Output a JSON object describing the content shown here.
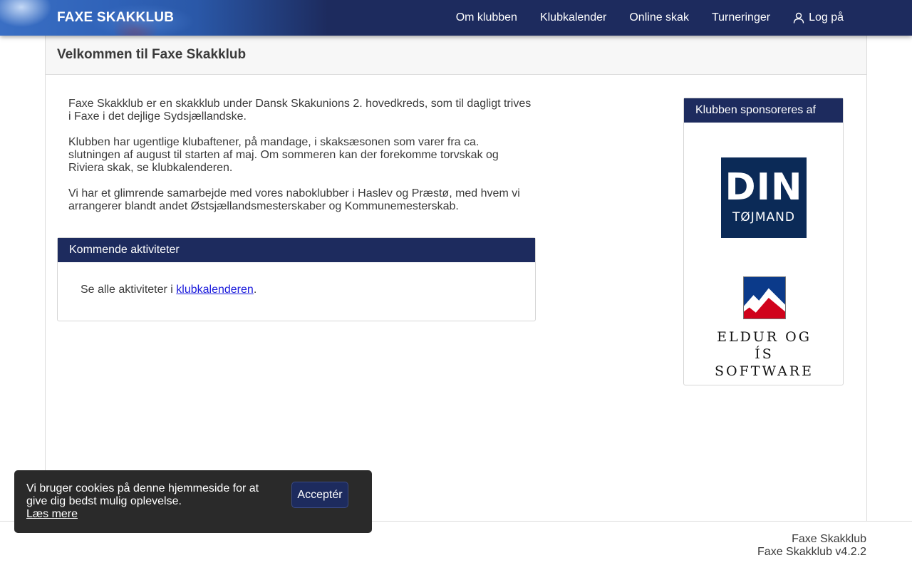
{
  "header": {
    "brand": "FAXE SKAKKLUB",
    "nav": [
      {
        "label": "Om klubben"
      },
      {
        "label": "Klubkalender"
      },
      {
        "label": "Online skak"
      },
      {
        "label": "Turneringer"
      },
      {
        "label": "Log på",
        "icon": "user-icon"
      }
    ]
  },
  "page": {
    "title": "Velkommen til Faxe Skakklub",
    "intro": [
      "Faxe Skakklub er en skakklub under Dansk Skakunions 2. hovedkreds, som til dagligt trives i Faxe i det dejlige Sydsjællandske.",
      "Klubben har ugentlige klubaftener, på mandage, i skaksæsonen som varer fra ca. slutningen af august til starten af maj. Om sommeren kan der forekomme torvskak og Riviera skak, se klubkalenderen.",
      "Vi har et glimrende samarbejde med vores naboklubber i Haslev og Præstø, med hvem vi arrangerer blandt andet Østsjællandsmesterskaber og Kommunemesterskab."
    ]
  },
  "activities": {
    "title": "Kommende aktiviteter",
    "text_before": "Se alle aktiviteter i ",
    "link_label": "klubkalenderen",
    "text_after": "."
  },
  "sponsors": {
    "title": "Klubben sponsoreres af",
    "din": {
      "line1": "DIN",
      "line2": "TØJMAND"
    },
    "eldur": {
      "line1": "ELDUR OG ÍS",
      "line2": "SOFTWARE"
    }
  },
  "footer": {
    "line1": "Faxe Skakklub",
    "line2": "Faxe Skakklub v4.2.2"
  },
  "cookie": {
    "text": "Vi bruger cookies på denne hjemmeside for at give dig bedst mulig oplevelse.",
    "link_label": "Læs mere",
    "button_label": "Acceptér"
  },
  "colors": {
    "navbar": "#1d2b5e",
    "link": "#1a1adb",
    "cookie_bg": "#2a2a2a",
    "din_blue": "#0b2a57",
    "eldur_red": "#d0021b"
  }
}
